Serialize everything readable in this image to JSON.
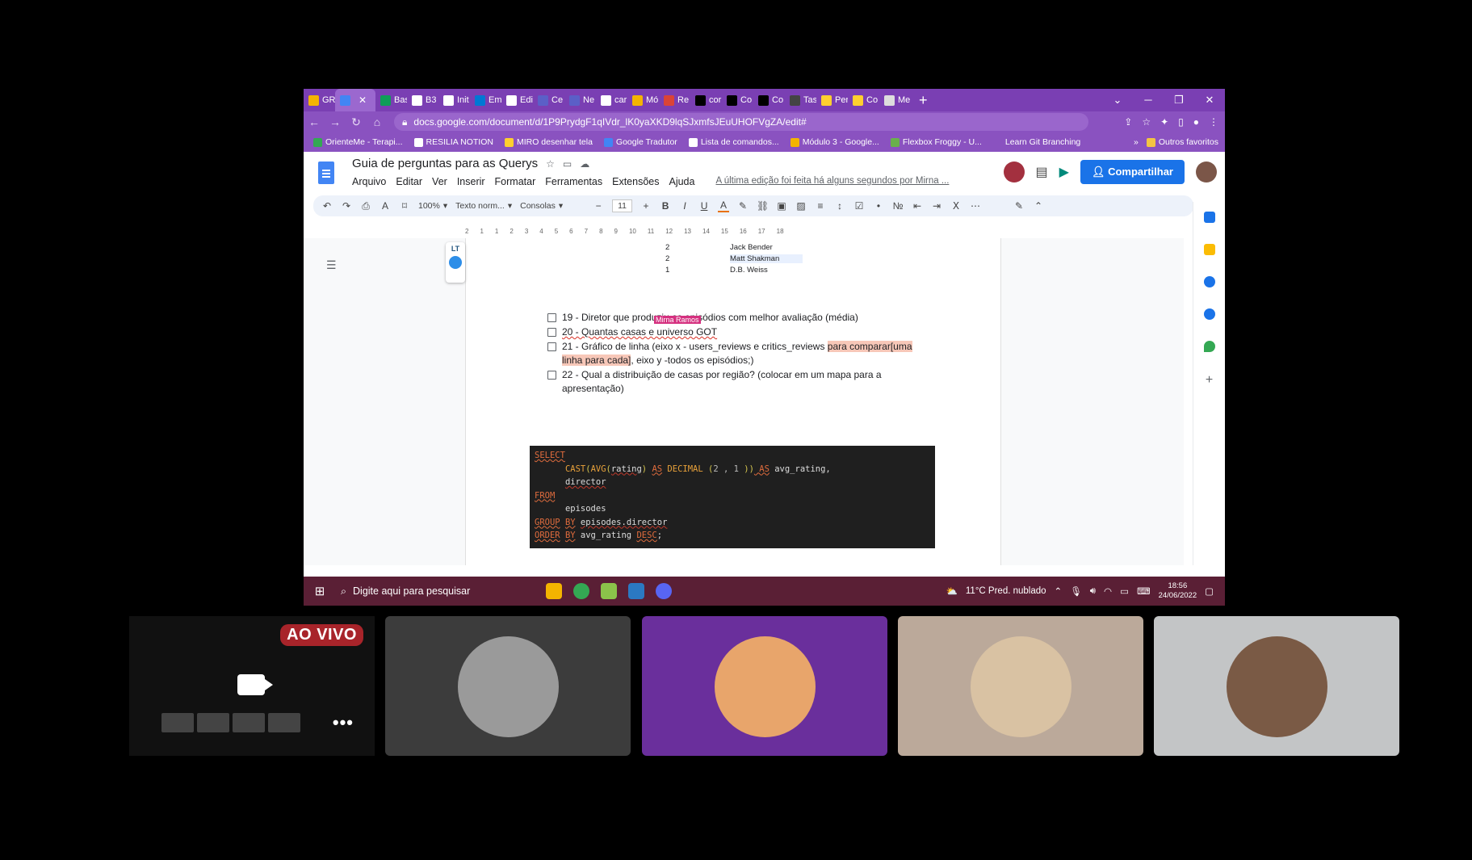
{
  "browser": {
    "tabs": [
      {
        "label": "GR",
        "icon": "google-drive-icon",
        "color": "#f4b400"
      },
      {
        "label": "",
        "icon": "google-docs-icon",
        "color": "#4285f4",
        "active": true
      },
      {
        "label": "Bas",
        "icon": "google-drive-icon",
        "color": "#0f9d58"
      },
      {
        "label": "B3",
        "icon": "github-icon",
        "color": "#ffffff"
      },
      {
        "label": "Init",
        "icon": "github-icon",
        "color": "#ffffff"
      },
      {
        "label": "Em",
        "icon": "outlook-icon",
        "color": "#0078d4"
      },
      {
        "label": "Edi",
        "icon": "github-icon",
        "color": "#ffffff"
      },
      {
        "label": "Ce",
        "icon": "teams-icon",
        "color": "#5b5fc7"
      },
      {
        "label": "Ne",
        "icon": "teams-icon",
        "color": "#5b5fc7"
      },
      {
        "label": "car",
        "icon": "bookmark-icon",
        "color": "#ffffff"
      },
      {
        "label": "Mó",
        "icon": "google-drive-icon",
        "color": "#f4b400"
      },
      {
        "label": "Re",
        "icon": "google-drive-icon",
        "color": "#db4437"
      },
      {
        "label": "cor",
        "icon": "dev-icon",
        "color": "#000000"
      },
      {
        "label": "Co",
        "icon": "codepen-icon",
        "color": "#000000"
      },
      {
        "label": "Co",
        "icon": "medium-icon",
        "color": "#000000"
      },
      {
        "label": "Tas",
        "icon": "check-icon",
        "color": "#444444"
      },
      {
        "label": "Per",
        "icon": "miro-icon",
        "color": "#ffd02f"
      },
      {
        "label": "Co",
        "icon": "miro-icon",
        "color": "#ffd02f"
      },
      {
        "label": "Me",
        "icon": "page-icon",
        "color": "#dddddd"
      }
    ],
    "close_tab": "✕",
    "new_tab": "+",
    "window_controls": [
      "⌄",
      "─",
      "❐",
      "✕"
    ],
    "url": "docs.google.com/document/d/1P9PrydgF1qIVdr_lK0yaXKD9lqSJxmfsJEuUHOFVgZA/edit#",
    "bookmarks": [
      {
        "label": "OrienteMe - Terapi...",
        "color": "#34a853"
      },
      {
        "label": "RESILIA NOTION",
        "color": "#ffffff"
      },
      {
        "label": "MIRO desenhar tela",
        "color": "#ffd02f"
      },
      {
        "label": "Google Tradutor",
        "color": "#4285f4"
      },
      {
        "label": "Lista de comandos...",
        "color": "#ffffff"
      },
      {
        "label": "Módulo 3 - Google...",
        "color": "#f4b400"
      },
      {
        "label": "Flexbox Froggy - U...",
        "color": "#6ab04c"
      },
      {
        "label": "Learn Git Branching",
        "color": "#8a52c0"
      }
    ],
    "bookmarks_more": "»",
    "other_favorites": "Outros favoritos"
  },
  "docs": {
    "title": "Guia de perguntas para  as Querys",
    "menus": [
      "Arquivo",
      "Editar",
      "Ver",
      "Inserir",
      "Formatar",
      "Ferramentas",
      "Extensões",
      "Ajuda"
    ],
    "last_edit": "A última edição foi feita há alguns segundos por Mirna ...",
    "share_label": "Compartilhar",
    "toolbar": {
      "zoom": "100%",
      "style": "Texto norm...",
      "font": "Consolas",
      "size": "11"
    },
    "ruler": [
      "2",
      "1",
      "1",
      "2",
      "3",
      "4",
      "5",
      "6",
      "7",
      "8",
      "9",
      "10",
      "11",
      "12",
      "13",
      "14",
      "15",
      "16",
      "17",
      "18"
    ],
    "lt_label": "LT",
    "table_rows": [
      {
        "count": "2",
        "name": "Jack Bender"
      },
      {
        "count": "2",
        "name": "Matt Shakman"
      },
      {
        "count": "1",
        "name": "D.B. Weiss"
      }
    ],
    "cursor_user": "Mirna Ramos",
    "tasks": {
      "t19": "19 - Diretor que produziu os episódios com melhor avaliação (média)",
      "t20": "20 - Quantas casas e universo GOT",
      "t21a": "21 - Gráfico de linha (eixo x - users_reviews e critics_reviews ",
      "t21b": "para comparar[uma linha para cada]",
      "t21c": ", eixo y -todos os episódios;)",
      "t22": "22 - Qual a distribuição de casas por região? (colocar em um mapa para a apresentação)"
    },
    "code": {
      "l1": "SELECT",
      "l2a": "CAST",
      "l2b": "(",
      "l2c": "AVG",
      "l2d": "(",
      "l2e": "rating",
      "l2f": ") ",
      "l2g": "AS",
      "l2h": " DECIMAL ",
      "l2i": "(",
      "l2j": "2 , 1",
      "l2k": " ))",
      "l2l": " AS",
      "l2m": " avg_rating,",
      "l3": "director",
      "l4": "FROM",
      "l5": "episodes",
      "l6a": "GROUP",
      "l6b": "BY",
      "l6c": "episodes.director",
      "l7a": "ORDER",
      "l7b": "BY",
      "l7c": " avg_rating ",
      "l7d": "DESC",
      "l7e": ";"
    }
  },
  "taskbar": {
    "search_placeholder": "Digite aqui para pesquisar",
    "weather": "11°C  Pred. nublado",
    "time": "18:56",
    "date": "24/06/2022"
  },
  "meeting": {
    "live_label": "AO VIVO",
    "more": "•••",
    "tiles": [
      {
        "bg": "#3c3c3c",
        "avatar": "#9a9a9a"
      },
      {
        "bg": "#6a2f9c",
        "avatar": "#e8a56b"
      },
      {
        "bg": "#bba99a",
        "avatar": "#d9c2a3"
      },
      {
        "bg": "#c3c5c6",
        "avatar": "#7a5a45"
      }
    ]
  }
}
